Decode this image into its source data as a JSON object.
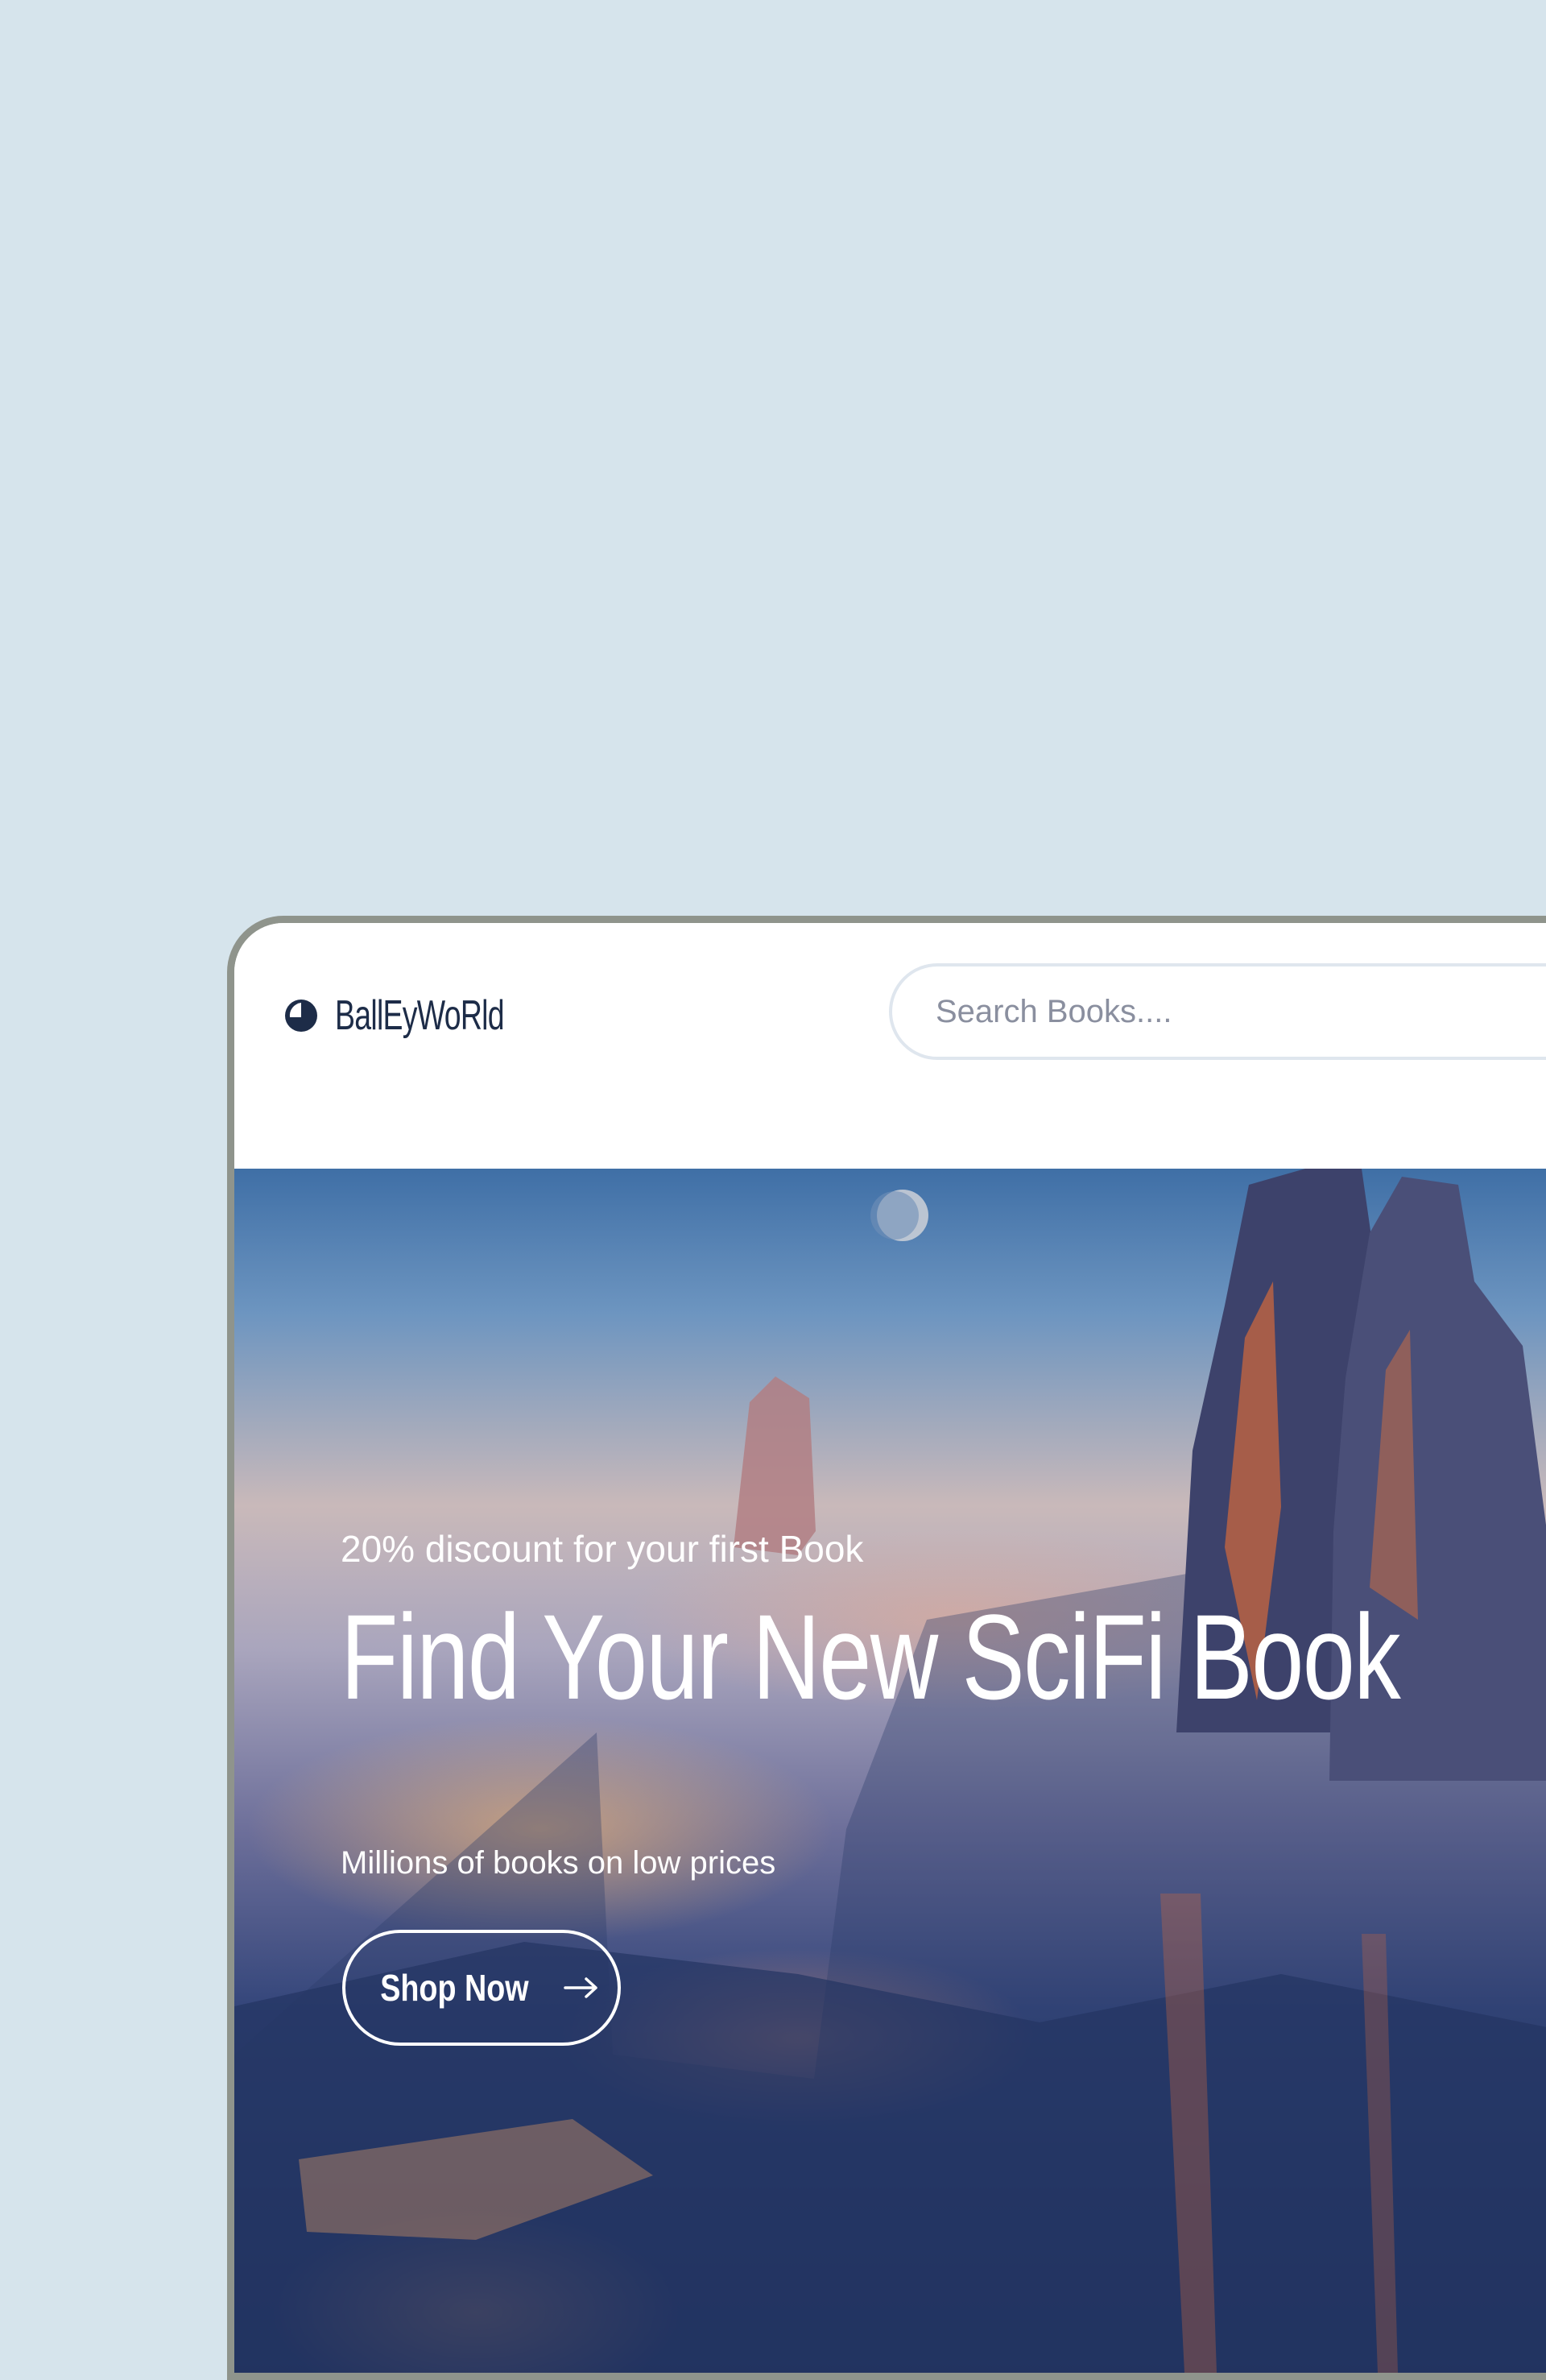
{
  "brand": {
    "name": "BallEyWoRld",
    "logo_icon": "half-moon-icon"
  },
  "search": {
    "placeholder": "Search Books....",
    "value": ""
  },
  "hero": {
    "promo": "20% discount for your first Book",
    "headline": "Find Your New SciFi Book",
    "subtext": "Millions of books on low prices",
    "cta_label": "Shop Now",
    "cta_icon": "arrow-right-icon"
  },
  "colors": {
    "page_background": "#d6e4ec",
    "brand_text": "#1d2c48",
    "placeholder": "#8a8f9f",
    "frame_border": "#8f948c"
  }
}
